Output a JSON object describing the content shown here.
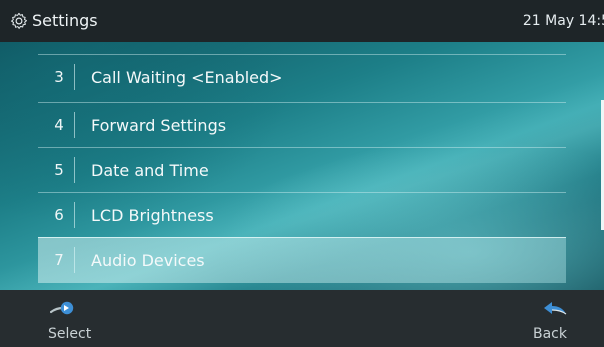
{
  "header": {
    "title": "Settings",
    "datetime": "21 May 14:5",
    "icon": "gear-icon"
  },
  "menu": {
    "items": [
      {
        "number": "3",
        "label": "Call Waiting <Enabled>",
        "selected": false
      },
      {
        "number": "4",
        "label": "Forward Settings",
        "selected": false
      },
      {
        "number": "5",
        "label": "Date and Time",
        "selected": false
      },
      {
        "number": "6",
        "label": "LCD Brightness",
        "selected": false
      },
      {
        "number": "7",
        "label": "Audio Devices",
        "selected": true
      }
    ]
  },
  "softkeys": {
    "left": {
      "label": "Select",
      "icon": "select-arrow-icon"
    },
    "right": {
      "label": "Back",
      "icon": "back-arrow-icon"
    }
  },
  "colors": {
    "accent": "#3aa8b0",
    "icon_blue": "#3d8fd6",
    "bar": "#1e2528"
  }
}
